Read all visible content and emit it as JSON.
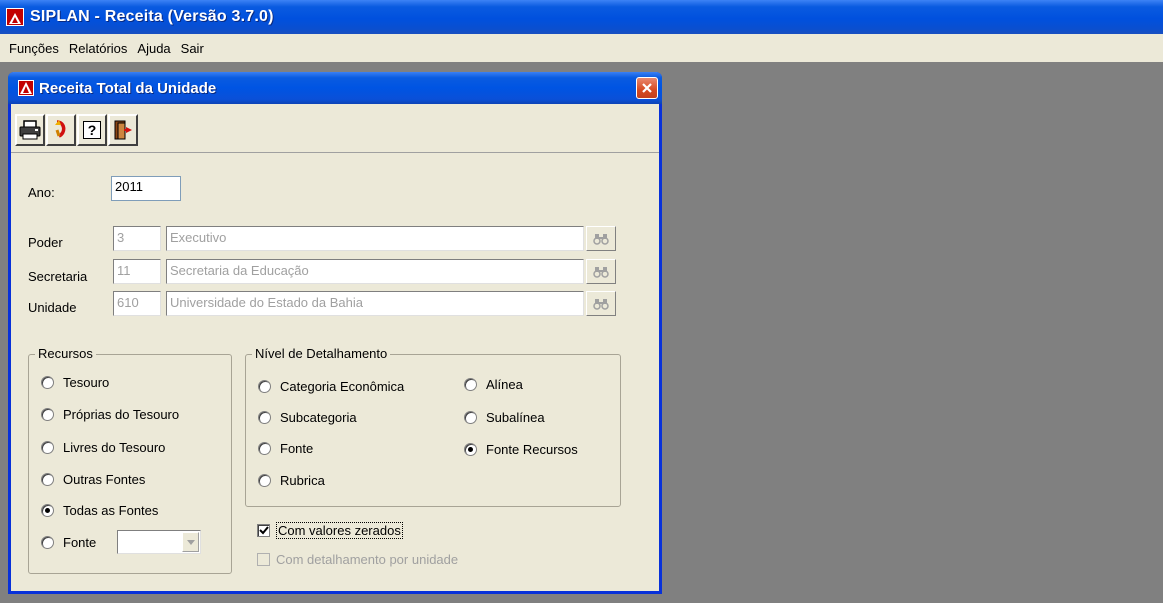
{
  "app": {
    "title": "SIPLAN - Receita (Versão 3.7.0)"
  },
  "menu": [
    "Funções",
    "Relatórios",
    "Ajuda",
    "Sair"
  ],
  "dialog": {
    "title": "Receita Total da Unidade"
  },
  "toolbar": {
    "buttons": [
      "print-icon",
      "undo-icon",
      "help-icon",
      "exit-icon"
    ],
    "help_label": "?"
  },
  "form": {
    "ano_label": "Ano:",
    "ano_value": "2011",
    "poder_label": "Poder",
    "poder_code": "3",
    "poder_name": "Executivo",
    "secretaria_label": "Secretaria",
    "secretaria_code": "11",
    "secretaria_name": "Secretaria da Educação",
    "unidade_label": "Unidade",
    "unidade_code": "610",
    "unidade_name": "Universidade do Estado da Bahia"
  },
  "recursos": {
    "label": "Recursos",
    "options": [
      "Tesouro",
      "Próprias do Tesouro",
      "Livres do Tesouro",
      "Outras Fontes",
      "Todas as Fontes",
      "Fonte"
    ],
    "selected": "Todas as Fontes",
    "fonte_value": ""
  },
  "nivel": {
    "label": "Nível de Detalhamento",
    "options": [
      "Categoria Econômica",
      "Subcategoria",
      "Fonte",
      "Rubrica",
      "Alínea",
      "Subalínea",
      "Fonte Recursos"
    ],
    "selected": "Fonte Recursos"
  },
  "checks": {
    "zerados_label": "Com valores zerados",
    "zerados_checked": true,
    "detalhamento_label": "Com detalhamento por unidade",
    "detalhamento_checked": false
  },
  "colors": {
    "xp_blue": "#0054e3",
    "dialog_bg": "#ece9d8",
    "workspace": "#808080"
  }
}
